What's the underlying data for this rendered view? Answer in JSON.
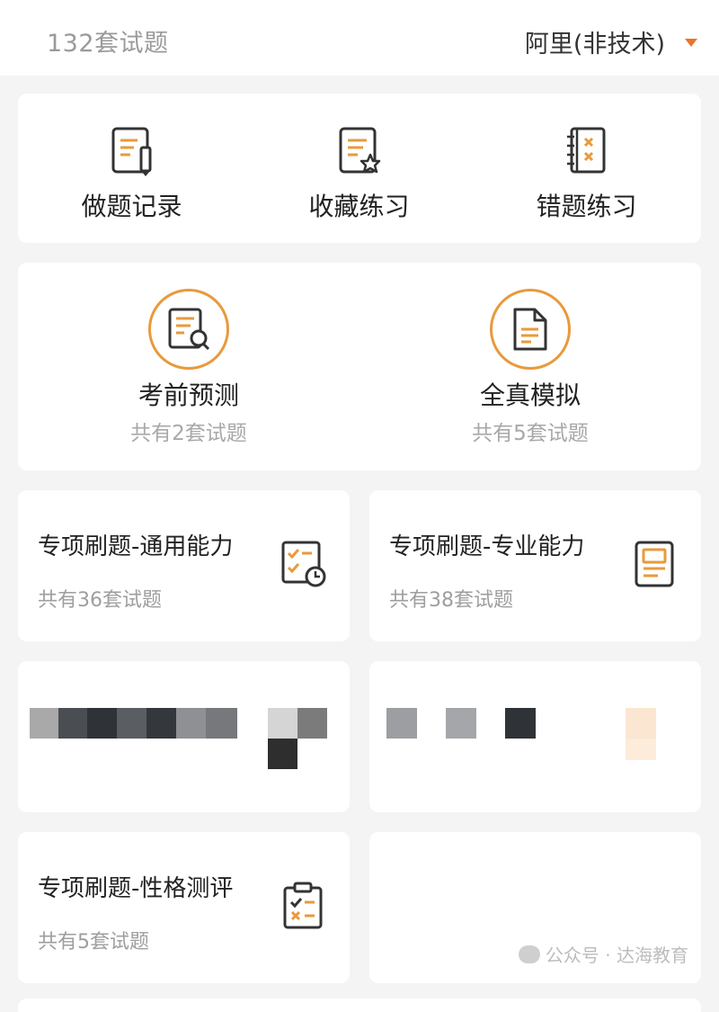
{
  "header": {
    "count_text": "132套试题",
    "company": "阿里(非技术)"
  },
  "quick_actions": [
    {
      "label": "做题记录",
      "icon": "record-edit-icon"
    },
    {
      "label": "收藏练习",
      "icon": "favorite-doc-icon"
    },
    {
      "label": "错题练习",
      "icon": "wrong-notebook-icon"
    }
  ],
  "mock_tests": [
    {
      "title": "考前预测",
      "subtitle": "共有2套试题",
      "icon": "doc-search-icon"
    },
    {
      "title": "全真模拟",
      "subtitle": "共有5套试题",
      "icon": "document-icon"
    }
  ],
  "topics": [
    {
      "title": "专项刷题-通用能力",
      "subtitle": "共有36套试题",
      "icon": "checklist-clock-icon"
    },
    {
      "title": "专项刷题-专业能力",
      "subtitle": "共有38套试题",
      "icon": "tablet-doc-icon"
    },
    {
      "title": "专项刷题-性格测评",
      "subtitle": "共有5套试题",
      "icon": "clipboard-check-icon"
    }
  ],
  "watermark": {
    "text": "公众号 · 达海教育"
  },
  "colors": {
    "accent": "#e89a3c",
    "caret": "#e8752a",
    "icon_stroke": "#333333"
  }
}
